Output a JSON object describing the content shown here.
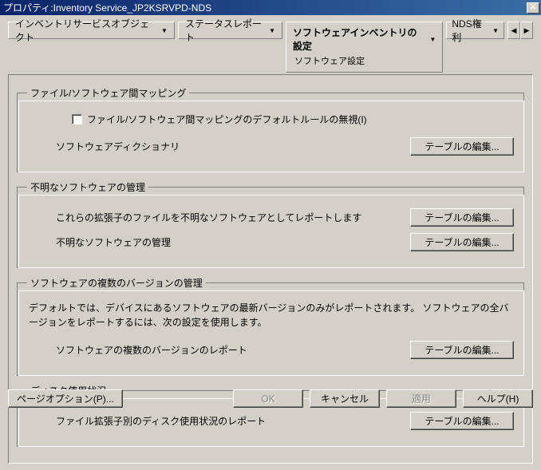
{
  "title": "プロパティ:Inventory Service_JP2KSRVPD-NDS",
  "tabs": {
    "inventory_object": "インベントリサービスオブジェクト",
    "status_report": "ステータスレポート",
    "software_settings": "ソフトウェアインベントリの設定",
    "software_settings_sub": "ソフトウェア設定",
    "nds_rights": "NDS権利"
  },
  "groups": {
    "file_mapping": {
      "legend": "ファイル/ソフトウェア間マッピング",
      "checkbox_label": "ファイル/ソフトウェア間マッピングのデフォルトルールの無視(I)",
      "dict_label": "ソフトウェアディクショナリ",
      "dict_button": "テーブルの編集..."
    },
    "unknown_sw": {
      "legend": "不明なソフトウェアの管理",
      "ext_label": "これらの拡張子のファイルを不明なソフトウェアとしてレポートします",
      "ext_button": "テーブルの編集...",
      "mgmt_label": "不明なソフトウェアの管理",
      "mgmt_button": "テーブルの編集..."
    },
    "versions": {
      "legend": "ソフトウェアの複数のバージョンの管理",
      "description": "デフォルトでは、デバイスにあるソフトウェアの最新バージョンのみがレポートされます。 ソフトウェアの全バージョンをレポートするには、次の設定を使用します。",
      "report_label": "ソフトウェアの複数のバージョンのレポート",
      "report_button": "テーブルの編集..."
    },
    "disk_usage": {
      "legend": "ディスク使用状況",
      "report_label": "ファイル拡張子別のディスク使用状況のレポート",
      "report_button": "テーブルの編集..."
    }
  },
  "footer": {
    "page_options": "ページオプション(P)...",
    "ok": "OK",
    "cancel": "キャンセル",
    "apply": "適用",
    "help": "ヘルプ(H)"
  }
}
